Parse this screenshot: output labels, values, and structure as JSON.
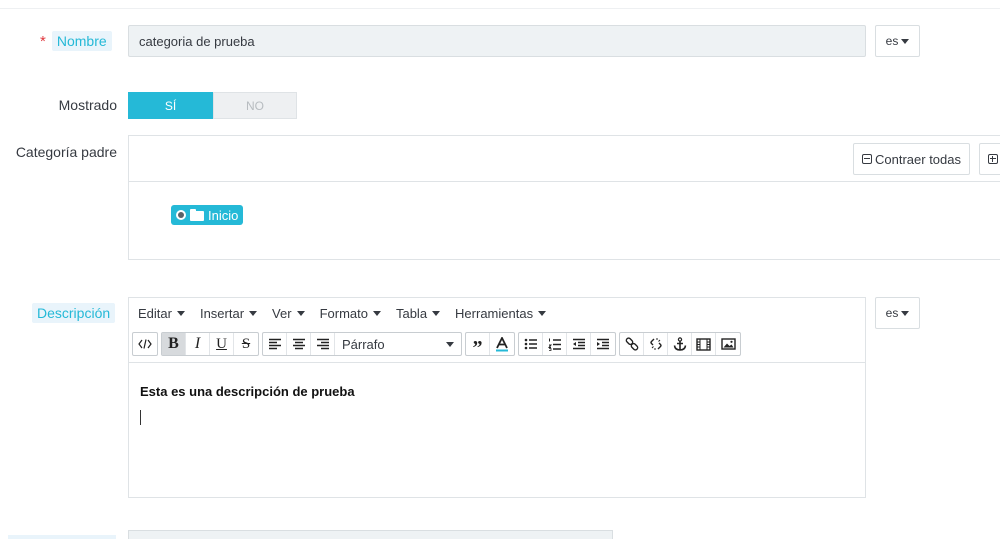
{
  "form": {
    "name": {
      "required_mark": "*",
      "label": "Nombre",
      "value": "categoria de prueba",
      "lang": "es"
    },
    "displayed": {
      "label": "Mostrado",
      "yes": "SÍ",
      "no": "NO",
      "selected": "SÍ"
    },
    "parent_category": {
      "label": "Categoría padre",
      "collapse_all": "Contraer todas",
      "tree": [
        {
          "label": "Inicio",
          "selected": true,
          "icon": "folder-icon"
        }
      ]
    },
    "description": {
      "label": "Descripción",
      "lang": "es",
      "menus": [
        "Editar",
        "Insertar",
        "Ver",
        "Formato",
        "Tabla",
        "Herramientas"
      ],
      "format_select": "Párrafo",
      "content": "Esta es una descripción de prueba"
    }
  },
  "colors": {
    "accent": "#25b9d7",
    "required": "#e0383e",
    "input_bg": "#eef2f4"
  }
}
